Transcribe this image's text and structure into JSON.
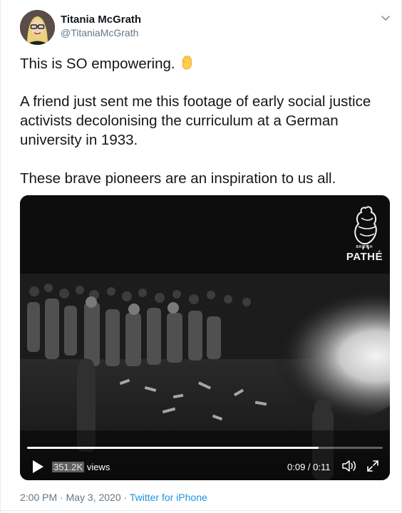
{
  "author": {
    "name": "Titania McGrath",
    "handle": "@TitaniaMcGrath"
  },
  "tweet": {
    "line1": "This is SO empowering.",
    "line1_emoji": "raised-fist-emoji",
    "line2": "A friend just sent me this footage of early social justice",
    "line3": "activists decolonising the curriculum at a German",
    "line4": "university in 1933.",
    "line5": "These brave pioneers are an inspiration to us all."
  },
  "video": {
    "watermark": "PATHÉ",
    "watermark_small": "BRITISH",
    "views_count": "351.2K",
    "views_label": " views",
    "time": "0:09 / 0:11",
    "progress": 0.82
  },
  "meta": {
    "timestamp": "2:00 PM · May 3, 2020 · ",
    "source": "Twitter for iPhone"
  },
  "icons": [
    "chevron-down-icon",
    "play-icon",
    "volume-icon",
    "fullscreen-icon"
  ],
  "colors": {
    "text": "#14171a",
    "secondary": "#657786",
    "link": "#1b95e0",
    "fist": "#ffcc4d"
  }
}
